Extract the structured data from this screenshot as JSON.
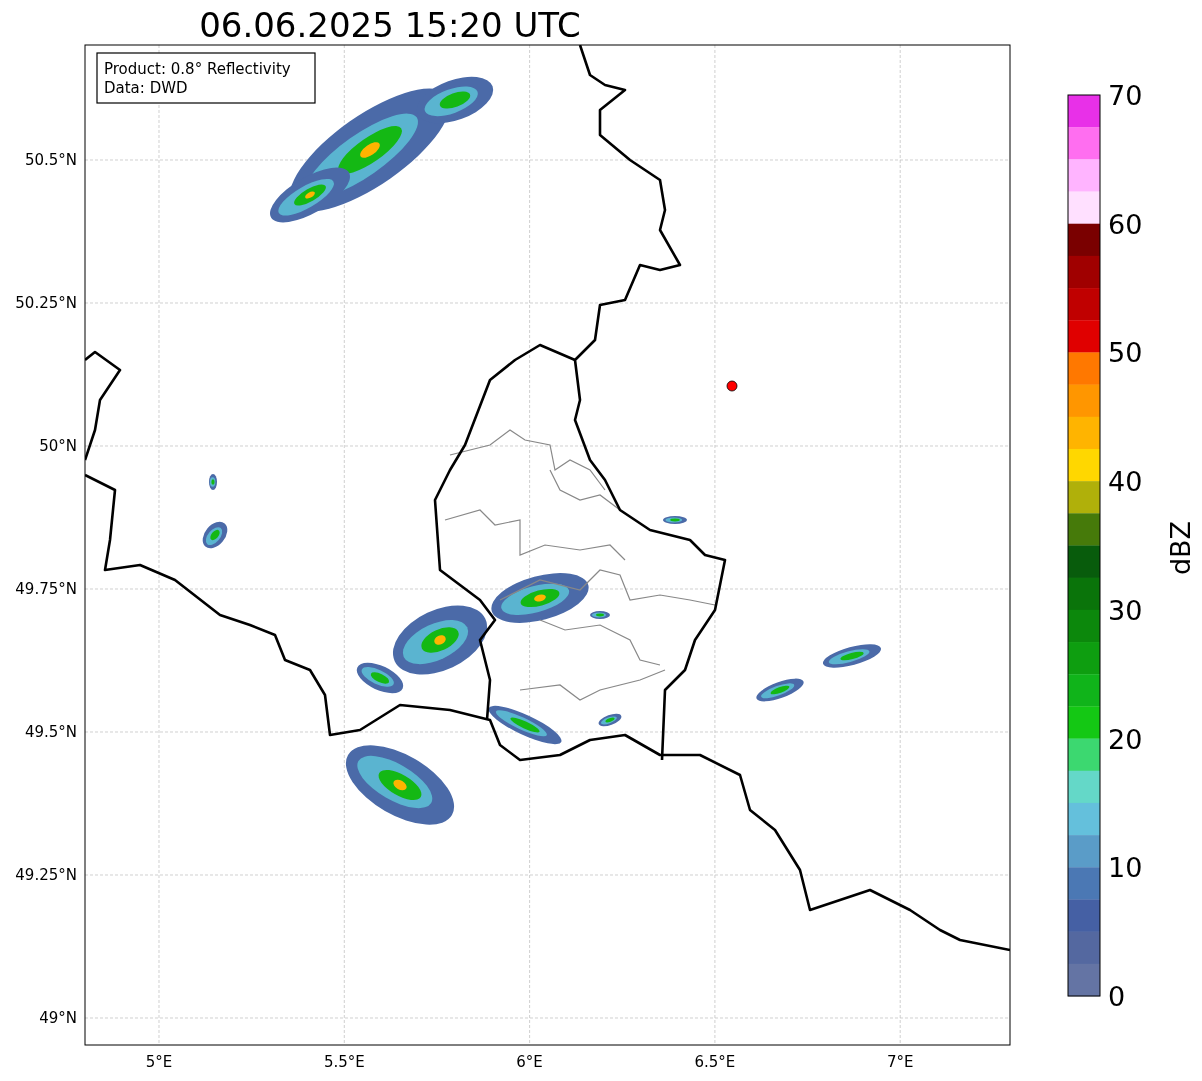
{
  "title": "06.06.2025 15:20 UTC",
  "info_box": [
    "Product: 0.8° Reflectivity",
    "Data: DWD"
  ],
  "map": {
    "lat_ticks": [
      "50.5°N",
      "50.25°N",
      "50°N",
      "49.75°N",
      "49.5°N",
      "49.25°N",
      "49°N"
    ],
    "lon_ticks": [
      "5°E",
      "5.5°E",
      "6°E",
      "6.5°E",
      "7°E"
    ]
  },
  "colorbar": {
    "label": "dBZ",
    "ticks": [
      "70",
      "60",
      "50",
      "40",
      "30",
      "20",
      "10",
      "0"
    ],
    "bands": [
      {
        "color": "#e830e8"
      },
      {
        "color": "#ff6ef0"
      },
      {
        "color": "#ffb4ff"
      },
      {
        "color": "#ffe0ff"
      },
      {
        "color": "#7a0000"
      },
      {
        "color": "#a00000"
      },
      {
        "color": "#c00000"
      },
      {
        "color": "#e00000"
      },
      {
        "color": "#ff7800"
      },
      {
        "color": "#ff9600"
      },
      {
        "color": "#ffb400"
      },
      {
        "color": "#ffd700"
      },
      {
        "color": "#b0b00a"
      },
      {
        "color": "#467a0a"
      },
      {
        "color": "#085c0c"
      },
      {
        "color": "#0a740a"
      },
      {
        "color": "#0c880c"
      },
      {
        "color": "#0e9e10"
      },
      {
        "color": "#10b41a"
      },
      {
        "color": "#14c814"
      },
      {
        "color": "#3cd870"
      },
      {
        "color": "#64d8c8"
      },
      {
        "color": "#64c0dc"
      },
      {
        "color": "#5a9cc8"
      },
      {
        "color": "#4b78b4"
      },
      {
        "color": "#4560a4"
      },
      {
        "color": "#5468a0"
      },
      {
        "color": "#6474a4"
      }
    ]
  }
}
